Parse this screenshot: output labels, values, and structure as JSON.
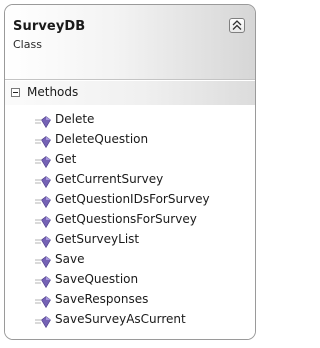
{
  "class": {
    "name": "SurveyDB",
    "stereotype": "Class"
  },
  "section": {
    "title": "Methods"
  },
  "methods": [
    "Delete",
    "DeleteQuestion",
    "Get",
    "GetCurrentSurvey",
    "GetQuestionIDsForSurvey",
    "GetQuestionsForSurvey",
    "GetSurveyList",
    "Save",
    "SaveQuestion",
    "SaveResponses",
    "SaveSurveyAsCurrent"
  ],
  "icons": {
    "method": "method-icon",
    "collapse": "collapse-double-chevron-up-icon",
    "section_toggle": "minus-box-icon"
  },
  "colors": {
    "method_icon": "#6b5aa6",
    "border": "#9a9a9a"
  }
}
